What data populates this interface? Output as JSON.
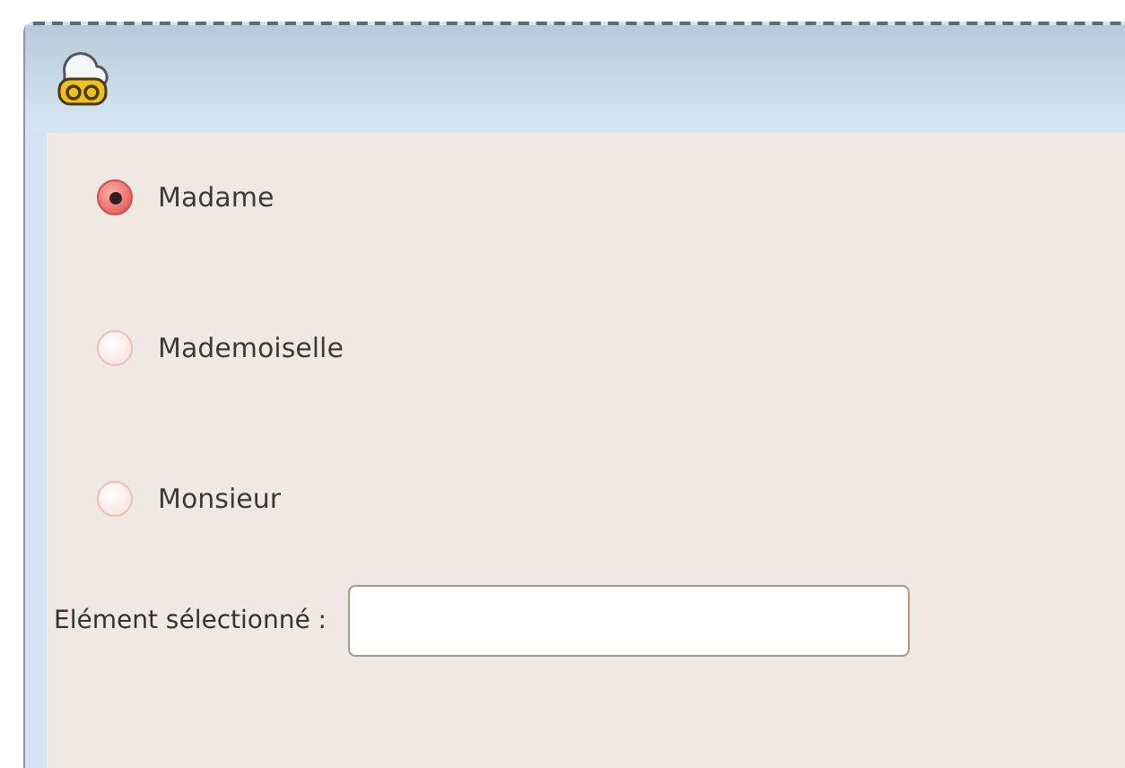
{
  "options": [
    {
      "label": "Madame",
      "selected": true
    },
    {
      "label": "Mademoiselle",
      "selected": false
    },
    {
      "label": "Monsieur",
      "selected": false
    }
  ],
  "selection_field": {
    "label": "Elément sélectionné :"
  }
}
